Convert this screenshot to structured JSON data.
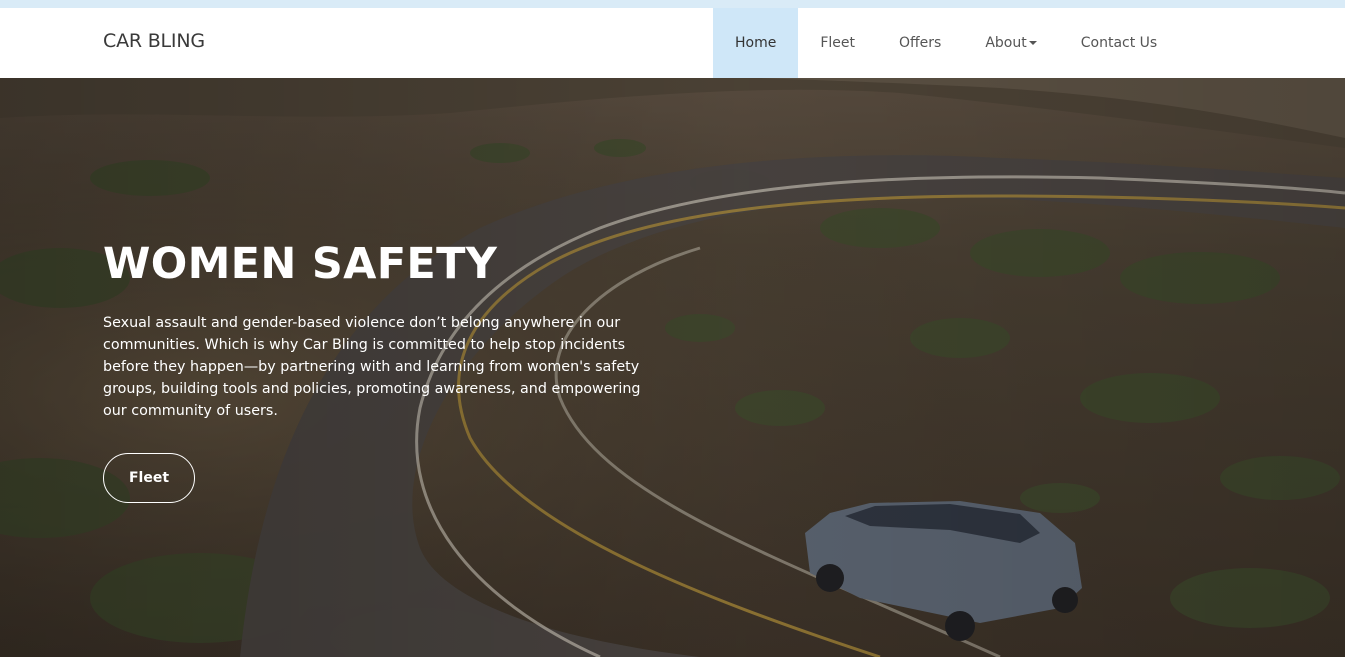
{
  "header": {
    "brand": "CAR BLING",
    "nav": [
      {
        "label": "Home",
        "active": true
      },
      {
        "label": "Fleet"
      },
      {
        "label": "Offers"
      },
      {
        "label": "About"
      },
      {
        "label": "Contact Us"
      }
    ]
  },
  "hero": {
    "title": "WOMEN SAFETY",
    "text": "Sexual assault and gender-based violence don’t belong anywhere in our communities. Which is why Car Bling is committed to help stop incidents before they happen—by partnering with and learning from women's safety groups, building tools and policies, promoting awareness, and empowering our community of users.",
    "button_label": "Fleet",
    "background_image": "aerial road through hills with SUV"
  },
  "colors": {
    "active_nav_bg": "#cfe7f8",
    "top_strip": "#d9ebf7"
  }
}
